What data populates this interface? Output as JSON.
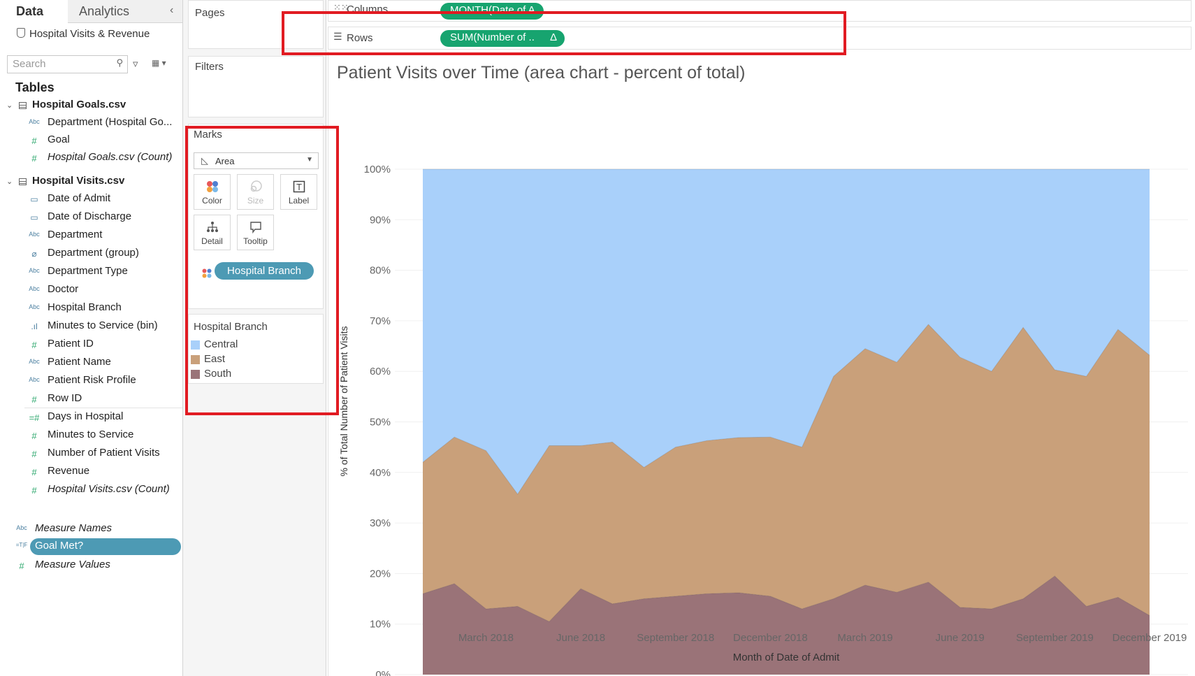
{
  "data_pane": {
    "tab_data": "Data",
    "tab_analytics": "Analytics",
    "collapse_glyph": "‹",
    "datasource": "Hospital Visits & Revenue",
    "search_placeholder": "Search",
    "tables_heading": "Tables",
    "tables": [
      {
        "name": "Hospital Goals.csv",
        "fields": [
          {
            "type": "Abc",
            "name": "Department (Hospital Go..."
          },
          {
            "type": "#",
            "name": "Goal"
          },
          {
            "type": "#",
            "name": "Hospital Goals.csv (Count)"
          }
        ]
      },
      {
        "name": "Hospital Visits.csv",
        "fields": [
          {
            "type": "date-icon",
            "name": "Date of Admit"
          },
          {
            "type": "date-icon",
            "name": "Date of Discharge"
          },
          {
            "type": "Abc",
            "name": "Department"
          },
          {
            "type": "clip-icon",
            "name": "Department (group)"
          },
          {
            "type": "Abc",
            "name": "Department Type"
          },
          {
            "type": "Abc",
            "name": "Doctor"
          },
          {
            "type": "Abc",
            "name": "Hospital Branch"
          },
          {
            "type": "bin-icon",
            "name": "Minutes to Service (bin)"
          },
          {
            "type": "#",
            "name": "Patient ID"
          },
          {
            "type": "Abc",
            "name": "Patient Name"
          },
          {
            "type": "Abc",
            "name": "Patient Risk Profile"
          },
          {
            "type": "#",
            "name": "Row ID"
          },
          {
            "type": "=#",
            "name": "Days in Hospital"
          },
          {
            "type": "#",
            "name": "Minutes to Service"
          },
          {
            "type": "#",
            "name": "Number of Patient Visits"
          },
          {
            "type": "#",
            "name": "Revenue"
          },
          {
            "type": "#",
            "name": "Hospital Visits.csv (Count)"
          }
        ]
      }
    ],
    "extra_fields": [
      {
        "type": "Abc",
        "name": "Measure Names"
      },
      {
        "type": "=T|F",
        "name": "Goal Met?"
      },
      {
        "type": "#",
        "name": "Measure Values"
      }
    ]
  },
  "shelves": {
    "pages": "Pages",
    "filters": "Filters",
    "columns_label": "Columns",
    "columns_pill": "MONTH(Date of A",
    "rows_label": "Rows",
    "rows_pill": "SUM(Number of ..",
    "rows_pill_delta": "Δ"
  },
  "marks": {
    "title": "Marks",
    "mark_type": "Area",
    "buttons": [
      "Color",
      "Size",
      "Label",
      "Detail",
      "Tooltip"
    ],
    "color_pill": "Hospital Branch"
  },
  "legend": {
    "title": "Hospital Branch",
    "items": [
      {
        "label": "Central",
        "color": "#a9d0fa"
      },
      {
        "label": "East",
        "color": "#c9a07a"
      },
      {
        "label": "South",
        "color": "#9a7378"
      }
    ]
  },
  "chart_data": {
    "type": "area",
    "title": "Patient Visits over Time (area chart - percent of total)",
    "xlabel": "Month of Date of Admit",
    "ylabel": "% of Total Number of Patient Visits",
    "ylim": [
      0,
      100
    ],
    "yticks": [
      "0%",
      "10%",
      "20%",
      "30%",
      "40%",
      "50%",
      "60%",
      "70%",
      "80%",
      "90%",
      "100%"
    ],
    "x": [
      "Jan 2018",
      "Feb 2018",
      "Mar 2018",
      "Apr 2018",
      "May 2018",
      "Jun 2018",
      "Jul 2018",
      "Aug 2018",
      "Sep 2018",
      "Oct 2018",
      "Nov 2018",
      "Dec 2018",
      "Jan 2019",
      "Feb 2019",
      "Mar 2019",
      "Apr 2019",
      "May 2019",
      "Jun 2019",
      "Jul 2019",
      "Aug 2019",
      "Sep 2019",
      "Oct 2019",
      "Nov 2019",
      "Dec 2019"
    ],
    "xtick_labels": [
      {
        "label": "March 2018",
        "index": 2
      },
      {
        "label": "June 2018",
        "index": 5
      },
      {
        "label": "September 2018",
        "index": 8
      },
      {
        "label": "December 2018",
        "index": 11
      },
      {
        "label": "March 2019",
        "index": 14
      },
      {
        "label": "June 2019",
        "index": 17
      },
      {
        "label": "September 2019",
        "index": 20
      },
      {
        "label": "December 2019",
        "index": 23
      }
    ],
    "stack": "percent",
    "series": [
      {
        "name": "South",
        "color": "#9a7378",
        "values": [
          16,
          18,
          13,
          13.5,
          10.5,
          17,
          14,
          15,
          15.5,
          16,
          16.2,
          15.5,
          13,
          15,
          17.7,
          16.3,
          18.3,
          13.3,
          13,
          15,
          19.5,
          13.5,
          15.3,
          11.7
        ]
      },
      {
        "name": "East",
        "color": "#c9a07a",
        "values": [
          26,
          29,
          31.3,
          22.2,
          34.8,
          28.3,
          32,
          26,
          29.5,
          30.3,
          30.7,
          31.5,
          32,
          44,
          46.8,
          45.5,
          51,
          49.5,
          47,
          53.7,
          40.8,
          45.5,
          53,
          51.5
        ]
      },
      {
        "name": "Central",
        "color": "#a9d0fa",
        "values": [
          58,
          53,
          55.7,
          64.3,
          54.7,
          54.7,
          54,
          59,
          55,
          53.7,
          53.1,
          53,
          55,
          41,
          35.5,
          38.2,
          30.7,
          37.2,
          40,
          31.3,
          39.7,
          41,
          31.7,
          36.8
        ]
      }
    ]
  }
}
